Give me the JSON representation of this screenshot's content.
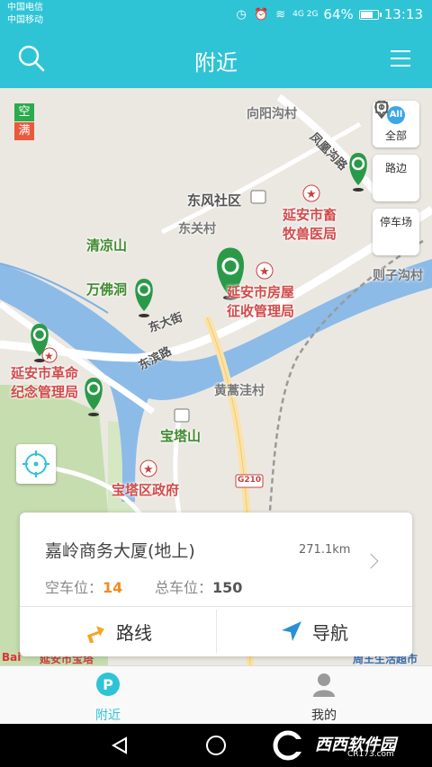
{
  "status_bar": {
    "carrier_1": "中国电信",
    "carrier_2": "中国移动",
    "network_tags": "4G 2G",
    "battery": "64%",
    "battery_level": 0.64,
    "time": "13:13"
  },
  "header": {
    "title": "附近",
    "search_icon": "search-icon",
    "menu_icon": "menu-icon"
  },
  "map": {
    "legend": {
      "empty": "空",
      "full": "满",
      "empty_color": "#2bab4d",
      "full_color": "#e9593e"
    },
    "filters": [
      {
        "icon_text": "All",
        "label": "全部"
      },
      {
        "label": "路边"
      },
      {
        "label": "停车场"
      }
    ],
    "labels": {
      "xiangyang": "向阳沟村",
      "dongfeng": "东风社区",
      "dongguan": "东关村",
      "xuhuo_road": "凤凰沟路",
      "animal_hospital": "延安市畜牧兽医局",
      "qingliang": "清凉山",
      "wanfo": "万佛洞",
      "zeizi": "则子沟村",
      "housing": "延安市房屋征收管理局",
      "dongda": "东大街",
      "binhe": "东滨路",
      "revolution": "延安市革命纪念管理局",
      "huanghao": "黄蒿洼村",
      "baota_shan": "宝塔山",
      "baota_gov": "宝塔区政府",
      "g210": "G210"
    },
    "bottom_strip": "延安市宝塔",
    "bottom_strip_right": "周王生活超市"
  },
  "card": {
    "name": "嘉岭商务大厦(地上)",
    "distance": "271.1km",
    "free_label": "空车位：",
    "free_value": "14",
    "total_label": "总车位：",
    "total_value": "150",
    "route_label": "路线",
    "nav_label": "导航",
    "accent": "#f08b24"
  },
  "tabbar": {
    "nearby": "附近",
    "mine": "我的",
    "active_color": "#2ec4d6"
  },
  "watermark": {
    "text": "西西软件园",
    "sub": "CR173.com"
  }
}
